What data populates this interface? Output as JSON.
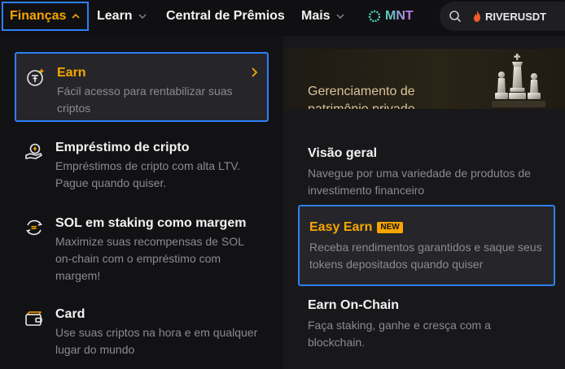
{
  "nav": {
    "financas": "Finanças",
    "learn": "Learn",
    "central": "Central de Prêmios",
    "mais": "Mais",
    "mnt": "MNT",
    "hot_token": "RIVERUSDT"
  },
  "left_menu": {
    "items": [
      {
        "title": "Earn",
        "desc": "Fácil acesso para rentabilizar suas criptos",
        "icon": "earn-coin-icon"
      },
      {
        "title": "Empréstimo de cripto",
        "desc": "Empréstimos de cripto com alta LTV. Pague quando quiser.",
        "icon": "loan-hand-icon"
      },
      {
        "title": "SOL em staking como margem",
        "desc": "Maximize suas recompensas de SOL on-chain com o empréstimo com margem!",
        "icon": "sol-cycle-icon"
      },
      {
        "title": "Card",
        "desc": "Use suas criptos na hora e em qualquer lugar do mundo",
        "icon": "card-wallet-icon"
      }
    ]
  },
  "right_menu": {
    "banner": {
      "line1": "Gerenciamento de",
      "line2": "patrimônio privado"
    },
    "items": [
      {
        "title": "Visão geral",
        "desc": "Navegue por uma variedade de produtos de investimento financeiro"
      },
      {
        "title": "Easy Earn",
        "badge": "NEW",
        "desc": "Receba rendimentos garantidos e saque seus tokens depositados quando quiser"
      },
      {
        "title": "Earn On-Chain",
        "desc": "Faça staking, ganhe e cresça com a blockchain."
      }
    ]
  },
  "colors": {
    "accent": "#f7a600",
    "highlight_border": "#2e7ff6",
    "muted_text": "#8a8b90"
  }
}
